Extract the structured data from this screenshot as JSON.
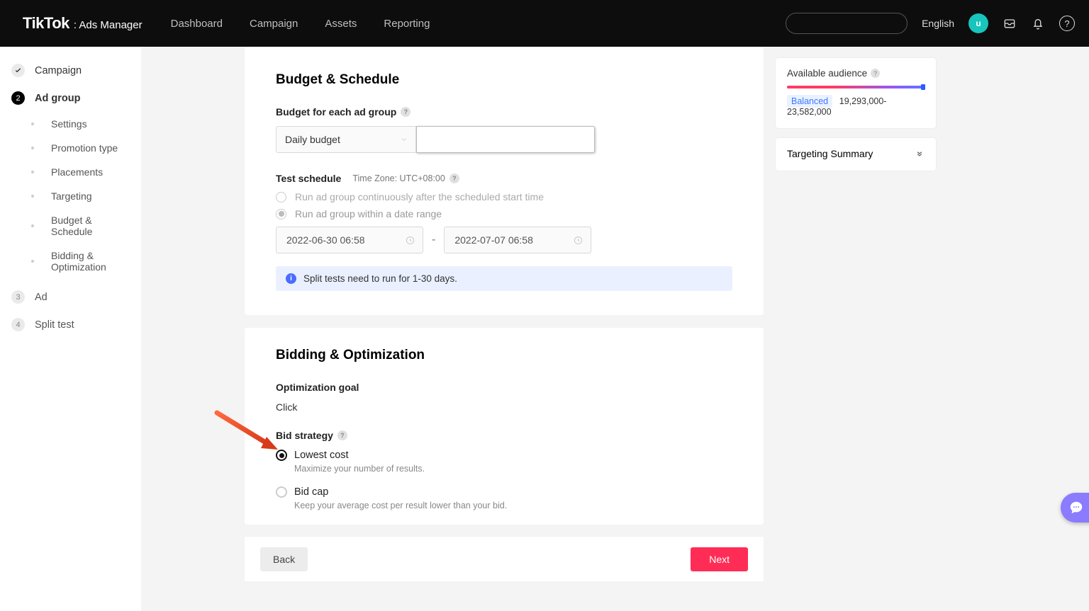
{
  "topbar": {
    "brand_main": "TikTok",
    "brand_sub": ": Ads Manager",
    "nav": [
      "Dashboard",
      "Campaign",
      "Assets",
      "Reporting"
    ],
    "lang": "English",
    "avatar_letter": "u"
  },
  "sidebar": {
    "steps": [
      {
        "label": "Campaign",
        "state": "done"
      },
      {
        "label": "Ad group",
        "state": "current"
      },
      {
        "label": "Ad",
        "state": "future",
        "num": "3"
      },
      {
        "label": "Split test",
        "state": "future",
        "num": "4"
      }
    ],
    "subitems": [
      "Settings",
      "Promotion type",
      "Placements",
      "Targeting",
      "Budget & Schedule",
      "Bidding & Optimization"
    ]
  },
  "budget_schedule": {
    "title": "Budget & Schedule",
    "budget_label": "Budget for each ad group",
    "budget_type": "Daily budget",
    "schedule_label": "Test schedule",
    "timezone": "Time Zone: UTC+08:00",
    "option_continuous": "Run ad group continuously after the scheduled start time",
    "option_range": "Run ad group within a date range",
    "start": "2022-06-30 06:58",
    "sep": "-",
    "end": "2022-07-07 06:58",
    "info": "Split tests need to run for 1-30 days."
  },
  "bidding": {
    "title": "Bidding & Optimization",
    "opt_goal_label": "Optimization goal",
    "opt_goal_value": "Click",
    "bid_strategy_label": "Bid strategy",
    "lowest_cost": "Lowest cost",
    "lowest_cost_desc": "Maximize your number of results.",
    "bid_cap": "Bid cap",
    "bid_cap_desc": "Keep your average cost per result lower than your bid."
  },
  "footer": {
    "back": "Back",
    "next": "Next"
  },
  "audience": {
    "title": "Available audience",
    "status": "Balanced",
    "range": "19,293,000-23,582,000"
  },
  "targeting_summary": {
    "title": "Targeting Summary"
  }
}
